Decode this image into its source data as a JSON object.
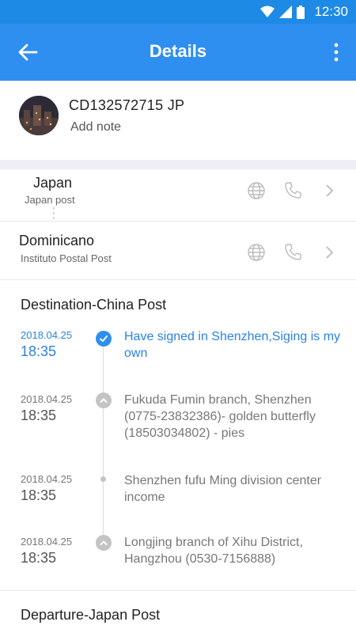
{
  "statusbar": {
    "time": "12:30",
    "icons": [
      "wifi-icon",
      "cellular-signal-icon",
      "battery-icon"
    ]
  },
  "appbar": {
    "title": "Details",
    "icons": [
      "back-arrow-icon",
      "more-vert-icon"
    ]
  },
  "package": {
    "tracking_number": "CD132572715 JP",
    "note_label": "Add note"
  },
  "route": [
    {
      "country": "Japan",
      "post": "Japan post"
    },
    {
      "country": "Dominicano",
      "post": "Instituto Postal Post"
    }
  ],
  "destination": {
    "title": "Destination-China Post",
    "events": [
      {
        "date": "2018.04.25",
        "time": "18:35",
        "desc": "Have signed in Shenzhen,Siging is my own"
      },
      {
        "date": "2018.04.25",
        "time": "18:35",
        "desc": "Fukuda Fumin branch, Shenzhen (0775-23832386)- golden butterfly  (18503034802) - pies"
      },
      {
        "date": "2018.04.25",
        "time": "18:35",
        "desc": "Shenzhen fufu Ming division center  income"
      },
      {
        "date": "2018.04.25",
        "time": "18:35",
        "desc": "Longjing branch of Xihu District, Hangzhou (0530-7156888)"
      }
    ]
  },
  "departure": {
    "title": "Departure-Japan Post"
  },
  "colors": {
    "primary": "#2f8ff0",
    "statusbar": "#1d8ae6",
    "active_text": "#2b82e4",
    "separator": "#eeeff4"
  }
}
